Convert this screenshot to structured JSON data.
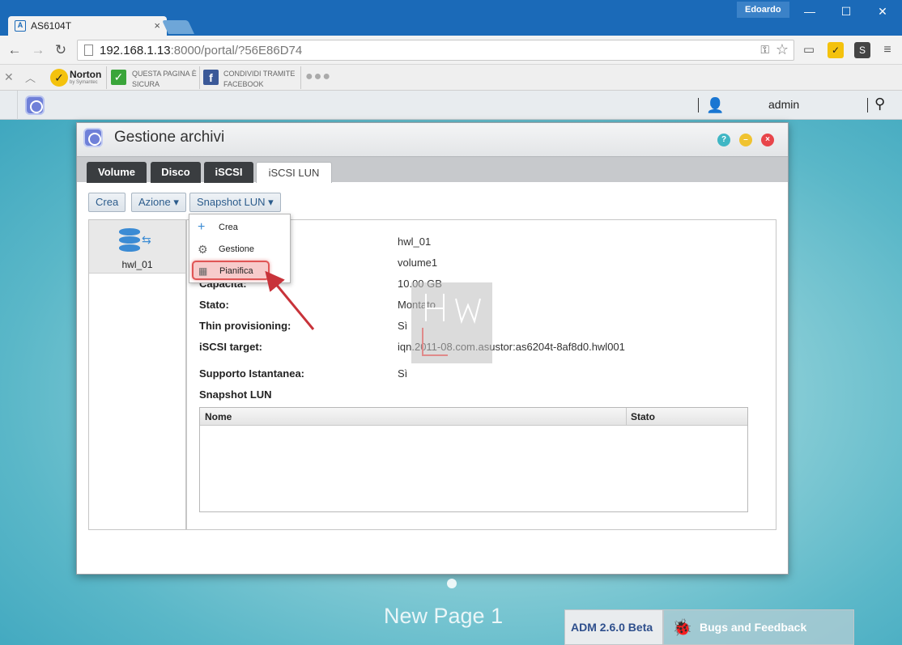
{
  "browser": {
    "tab_title": "AS6104T",
    "tab_favicon": "A",
    "tab_close": "×",
    "profile_name": "Edoardo",
    "window_controls": {
      "minimize": "—",
      "maximize": "☐",
      "close": "✕"
    },
    "url_host": "192.168.1.13",
    "url_rest": ":8000/portal/?56E86D74"
  },
  "norton_bar": {
    "logo_text": "Norton",
    "logo_sub": "by Symantec",
    "safe_line1": "QUESTA PAGINA È",
    "safe_line2": "SICURA",
    "share_line1": "CONDIVIDI TRAMITE",
    "share_line2": "FACEBOOK",
    "more": "●●●"
  },
  "adm": {
    "user": "admin"
  },
  "window": {
    "title": "Gestione archivi",
    "tabs": [
      {
        "label": "Volume"
      },
      {
        "label": "Disco"
      },
      {
        "label": "iSCSI"
      },
      {
        "label": "iSCSI LUN"
      }
    ],
    "toolbar": {
      "create": "Crea",
      "action": "Azione ▾",
      "snapshot": "Snapshot LUN ▾"
    },
    "lun_list": [
      {
        "name": "hwl_01"
      }
    ],
    "props": {
      "capacity_label": "Capacità:",
      "status_label": "Stato:",
      "thin_label": "Thin provisioning:",
      "target_label": "iSCSI target:",
      "snapshot_support_label": "Supporto Istantanea:",
      "snapshot_lun_label": "Snapshot LUN",
      "name_value": "hwl_01",
      "volume_value": "volume1",
      "capacity_value": "10.00 GB",
      "status_value": "Montato",
      "thin_value": "Sì",
      "target_value": "iqn.2011-08.com.asustor:as6204t-8af8d0.hwl001",
      "snapshot_support_value": "Sì"
    },
    "snapshot_table": {
      "columns": [
        "Nome",
        "Stato"
      ]
    },
    "dropdown": [
      {
        "label": "Crea",
        "icon": "plus-icon"
      },
      {
        "label": "Gestione",
        "icon": "gear-icon"
      },
      {
        "label": "Pianifica",
        "icon": "calendar-icon"
      }
    ]
  },
  "desktop": {
    "page_label": "New Page 1",
    "adm_version": "ADM 2.6.0 Beta",
    "bugs_label": "Bugs and Feedback"
  },
  "colors": {
    "chrome_blue": "#1b6ab8",
    "tab_dark": "#3a3d40",
    "link_blue": "#2c5c8c",
    "highlight_red": "#e05555"
  }
}
